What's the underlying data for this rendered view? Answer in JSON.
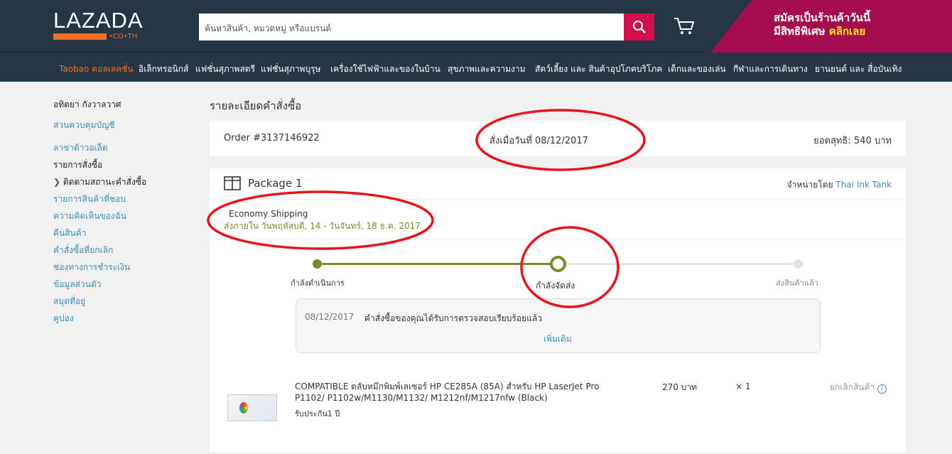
{
  "header": {
    "logo": "LAZADA",
    "logo_sub": "•CO•TH",
    "search_placeholder": "ค้นหาสินค้า, หมวดหมู่ หรือแบรนด์",
    "promo_line1": "สมัครเป็นร้านค้าวันนี้",
    "promo_line2": "มีสิทธิพิเศษ",
    "promo_cta": "คลิกเลย",
    "colors": {
      "bg": "#263645",
      "search_button": "#d0104c",
      "promo": "#a50e4e",
      "accent": "#f36f21"
    }
  },
  "nav": [
    "Taobao คอลเลคชั่น",
    "อิเล็กทรอนิกส์",
    "แฟชั่นสุภาพสตรี",
    "แฟชั่นสุภาพบุรุษ",
    "เครื่องใช้ไฟฟ้าและของในบ้าน",
    "สุขภาพและความงาม",
    "สัตว์เลี้ยง และ สินค้าอุปโภคบริโภค",
    "เด็กและของเล่น",
    "กีฬาและการเดินทาง",
    "ยานยนต์ และ สื่อบันเทิง"
  ],
  "sidebar": {
    "user": "อทิตยา กังวาลวาศ",
    "account": "ส่วนควบคุมบัญชี",
    "items": [
      "ลาซาด้าวอเล็ต",
      "รายการสั่งซื้อ",
      "ติดตามสถานะคำสั่งซื้อ",
      "รายการสินค้าที่ชอบ",
      "ความคิดเห็นของฉัน",
      "คืนสินค้า",
      "คำสั่งซื้อที่ยกเลิก",
      "ช่องทางการชำระเงิน",
      "ข้อมูลส่วนตัว",
      "สมุดที่อยู่",
      "คูปอง"
    ]
  },
  "page_title": "รายละเอียดคำสั่งซื้อ",
  "order": {
    "number": "Order #3137146922",
    "date": "สั่งเมื่อวันที่ 08/12/2017",
    "total": "ยอดสุทธิ: 540 บาท"
  },
  "package": {
    "title": "Package 1",
    "sold_by": "จำหน่ายโดย",
    "seller": "Thai Ink Tank",
    "shipping": "Economy Shipping",
    "eta": "ส่งภายใน วันพฤหัสบดี, 14 - วันจันทร์, 18 ธ.ค. 2017",
    "steps": [
      "กำลังดำเนินการ",
      "กำลังจัดส่ง",
      "ส่งสินค้าแล้ว"
    ],
    "current_step": 2,
    "log_date": "08/12/2017",
    "log_text": "คำสั่งซื้อของคุณได้รับการตรวจสอบเรียบร้อยแล้ว",
    "more": "เพิ่มเติม",
    "item": {
      "name_line1": "COMPATIBLE ตลับหมึกพิมพ์เลเซอร์ HP CE285A (85A) สำหรับ HP LaserJet Pro",
      "name_line2": "P1102/ P1102w/M1130/M1132/ M1212nf/M1217nfw (Black)",
      "warranty": "รับประกัน1 ปี",
      "price": "270 บาท",
      "qty": "× 1",
      "cancel": "ยกเลิกสินค้า"
    },
    "color": "#7a8c2a"
  }
}
